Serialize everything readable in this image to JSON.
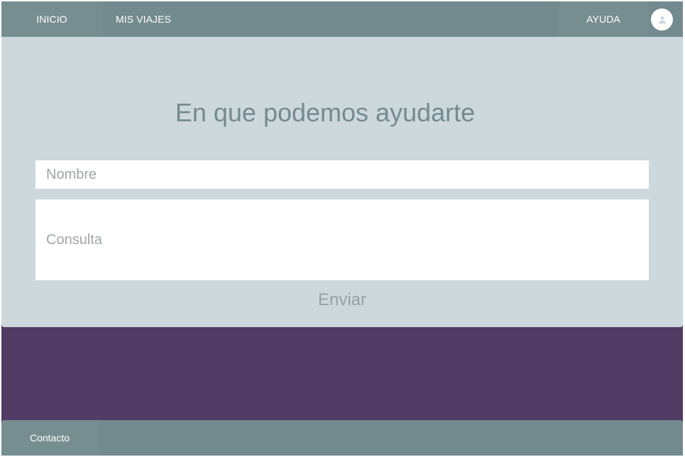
{
  "nav": {
    "inicio": "INICIO",
    "mis_viajes": "MIS VIAJES",
    "ayuda": "AYUDA",
    "avatar_icon": "user-icon"
  },
  "help": {
    "title": "En que podemos ayudarte",
    "nombre_placeholder": "Nombre",
    "nombre_value": "",
    "consulta_placeholder": "Consulta",
    "consulta_value": "",
    "submit_label": "Enviar"
  },
  "footer": {
    "contacto": "Contacto"
  },
  "colors": {
    "nav_bg": "#738b8e",
    "card_bg": "#cdd8dd",
    "page_bg": "#513a63",
    "title": "#738b8e"
  }
}
